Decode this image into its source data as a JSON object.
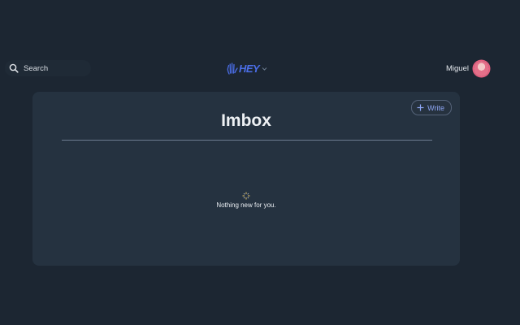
{
  "header": {
    "search_label": "Search",
    "logo_text": "HEY",
    "user_name": "Miguel"
  },
  "main": {
    "write_label": "Write",
    "title": "Imbox",
    "empty_message": "Nothing new for you."
  },
  "colors": {
    "background": "#1c2632",
    "card": "#253240",
    "brand_blue": "#4b6ee8",
    "write_accent": "#8ea6f5"
  },
  "icons": {
    "search": "search-icon",
    "logo": "hand-logo-icon",
    "chevron": "chevron-down-icon",
    "plus": "plus-icon",
    "empty": "sparkle-icon"
  }
}
